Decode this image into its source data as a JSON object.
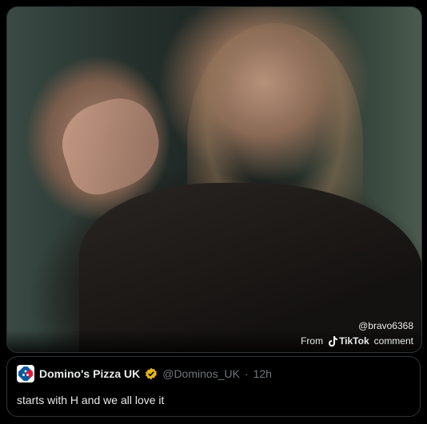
{
  "media": {
    "watermark": "@bravo6368",
    "source_from": "From",
    "source_name": "TikTok",
    "source_suffix": "comment"
  },
  "quote": {
    "author": "Domino's Pizza UK",
    "verified": true,
    "handle": "@Dominos_UK",
    "separator": "·",
    "time": "12h",
    "text": "starts with H and we all love it"
  },
  "colors": {
    "background": "#000000",
    "border": "#2f3336",
    "text": "#e7e9ea",
    "muted": "#71767b",
    "verified_badge": "#e2b719",
    "dominos_blue": "#0b5a9c",
    "dominos_red": "#e31837"
  },
  "icons": {
    "tiktok": "tiktok-note-icon",
    "verified": "verified-badge-icon",
    "avatar": "dominos-logo-icon"
  }
}
